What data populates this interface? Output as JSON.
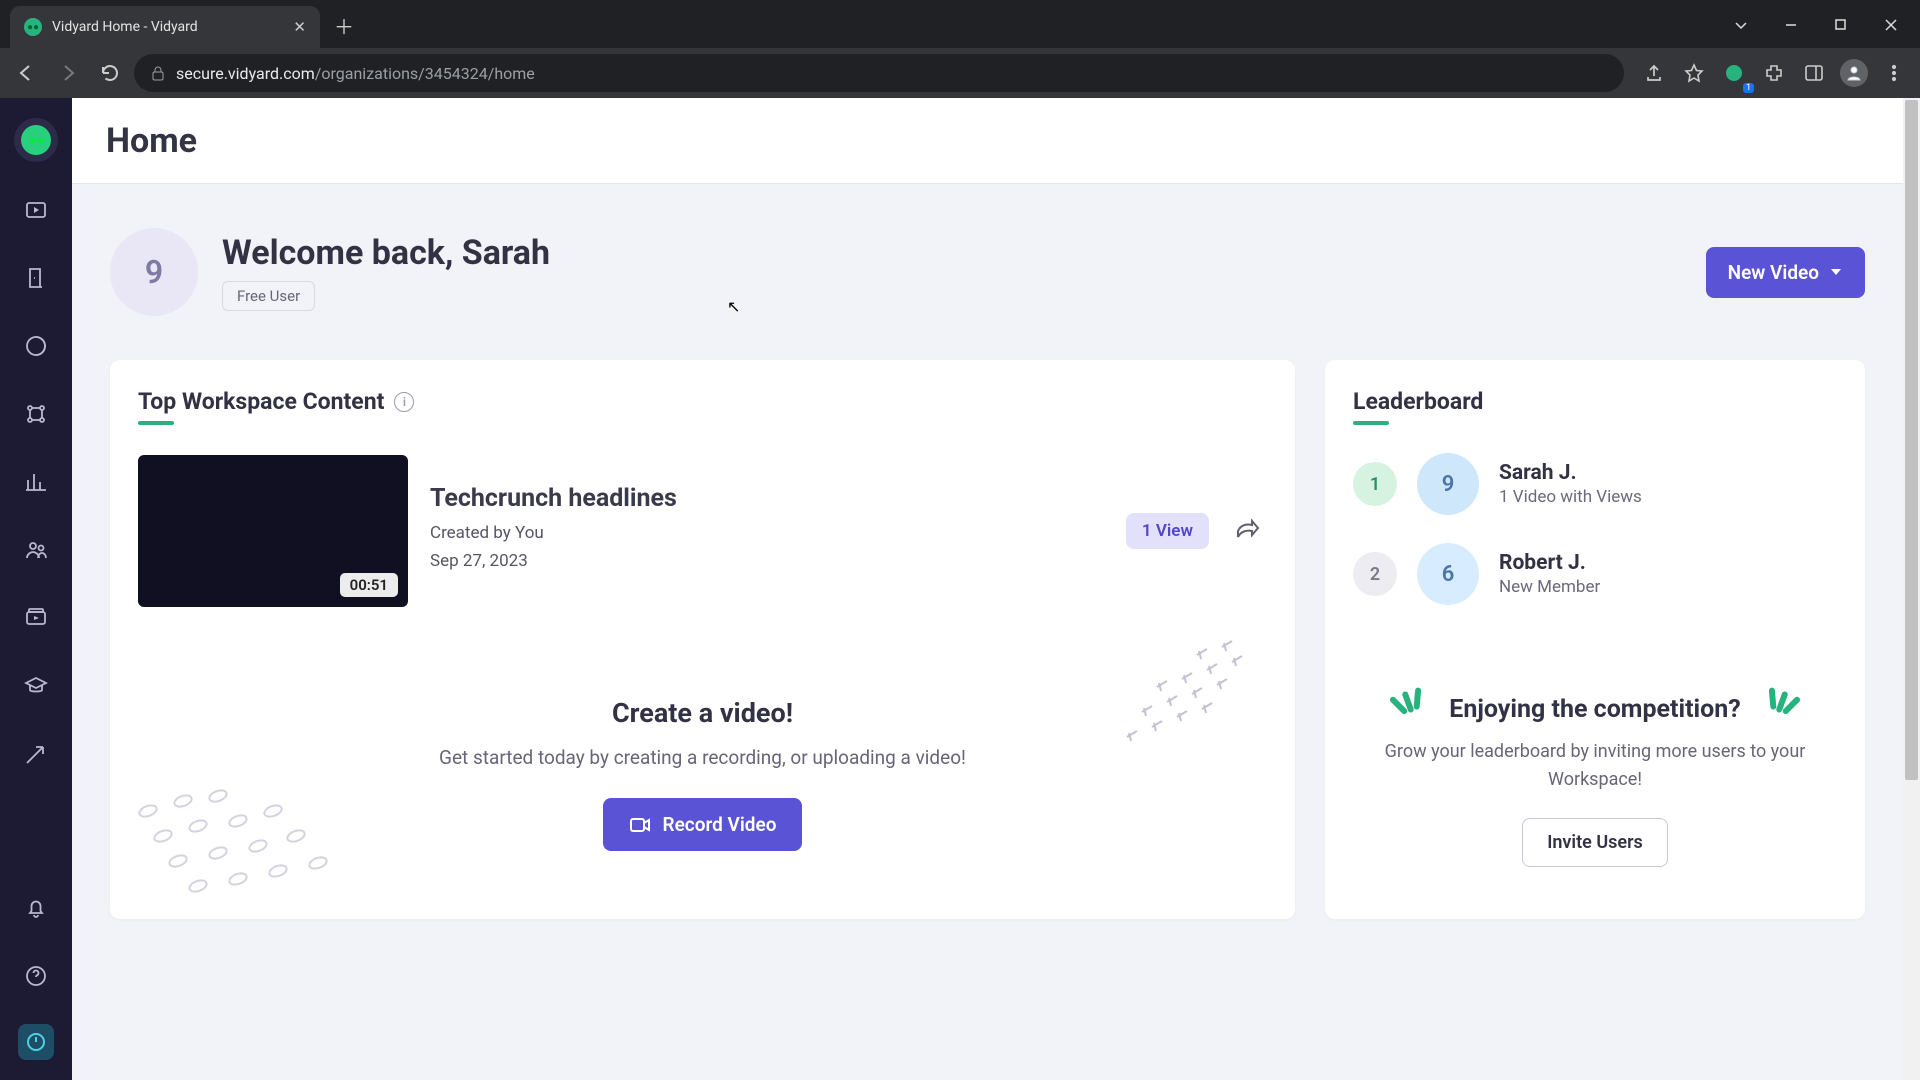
{
  "browser": {
    "tab_title": "Vidyard Home - Vidyard",
    "url_host": "secure.vidyard.com",
    "url_path": "/organizations/3454324/home",
    "ext_badge": "1"
  },
  "page": {
    "title": "Home"
  },
  "welcome": {
    "avatar_initial": "9",
    "heading": "Welcome back, Sarah",
    "plan_badge": "Free User",
    "new_video_label": "New Video"
  },
  "workspace": {
    "title": "Top Workspace Content",
    "video": {
      "title": "Techcrunch headlines",
      "creator": "Created by You",
      "date": "Sep 27, 2023",
      "duration": "00:51",
      "views_label": "1 View"
    },
    "create": {
      "heading": "Create a video!",
      "sub": "Get started today by creating a recording, or uploading a video!",
      "button": "Record Video"
    }
  },
  "leaderboard": {
    "title": "Leaderboard",
    "rows": [
      {
        "rank": "1",
        "avatar": "9",
        "name": "Sarah J.",
        "sub": "1 Video with Views"
      },
      {
        "rank": "2",
        "avatar": "6",
        "name": "Robert J.",
        "sub": "New Member"
      }
    ],
    "invite": {
      "heading": "Enjoying the competition?",
      "sub": "Grow your leaderboard by inviting more users to your Workspace!",
      "button": "Invite Users"
    }
  }
}
